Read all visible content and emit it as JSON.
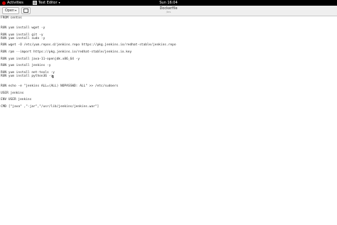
{
  "topbar": {
    "activities": "Activities",
    "app_menu": "Text Editor",
    "clock": "Sun 16:04"
  },
  "header": {
    "open_label": "Open",
    "title": "Dockerfile",
    "subtitle": "/tes"
  },
  "editor": {
    "lines": [
      "FROM centos",
      "",
      "",
      "RUN yum install wget -y",
      "",
      "RUN yum install git -y",
      "RUN yum install sudo -y",
      "",
      "RUN wget -O /etc/yum.repos.d/jenkins.repo https://pkg.jenkins.io/redhat-stable/jenkins.repo",
      "",
      "RUN rpm --import https://pkg.jenkins.io/redhat-stable/jenkins.io.key",
      "",
      "RUN yum install java-11-openjdk.x86_64 -y",
      "",
      "RUN yum install jenkins -y",
      "",
      "RUN yum install net-tools -y",
      "RUN yum install python36 -y",
      "",
      "",
      "RUN echo -e \"jenkins ALL=(ALL) NOPASSWD: ALL\" >> /etc/sudoers",
      "",
      "USER jenkins",
      "",
      "ENV USER jenkins",
      "",
      "CMD [\"java\" ,\"-jar\",\"/usr/lib/jenkins/jenkins.war\"]"
    ]
  }
}
